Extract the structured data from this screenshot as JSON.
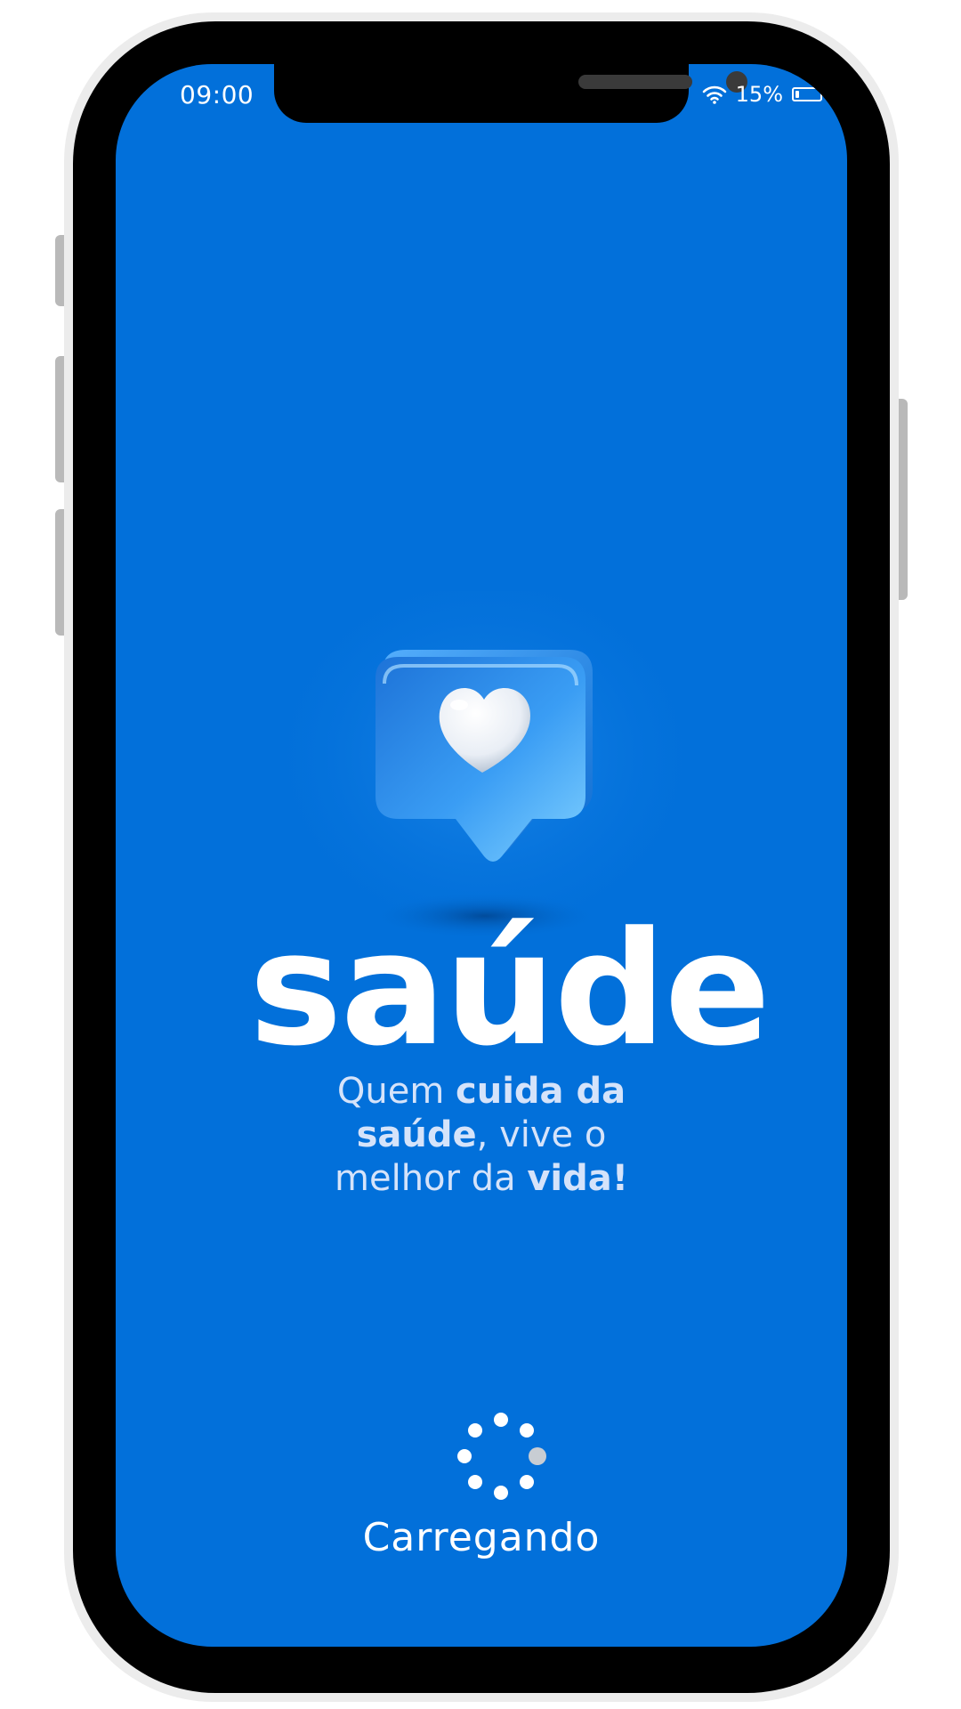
{
  "status_bar": {
    "time": "09:00",
    "battery_percent_label": "15%",
    "battery_level": 0.15,
    "wifi_icon": "wifi-icon",
    "battery_icon": "battery-icon"
  },
  "splash": {
    "logo_icon": "heart-speech-bubble-icon",
    "title": "saúde",
    "tagline": {
      "line1_regular": "Quem ",
      "line1_bold": "cuida da",
      "line2_bold": "saúde",
      "line2_regular": ", vive o",
      "line3_regular": "melhor da ",
      "line3_bold": "vida!"
    },
    "loading_label": "Carregando",
    "loading_icon": "loading-spinner-icon"
  },
  "colors": {
    "screen_background": "#0270da",
    "text_primary": "#ffffff",
    "text_tagline": "#d5e3fa",
    "device_frame": "#ececec",
    "device_bezel": "#000000"
  }
}
